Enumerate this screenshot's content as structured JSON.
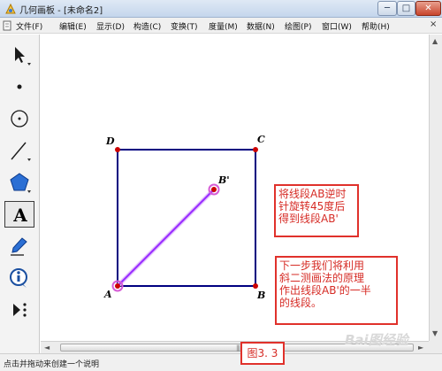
{
  "window": {
    "title": "几何画板 - [未命名2]",
    "minimize": "─",
    "maximize": "□",
    "close": "✕"
  },
  "menu": {
    "items": [
      "文件(F)",
      "编辑(E)",
      "显示(D)",
      "构造(C)",
      "变换(T)",
      "度量(M)",
      "数据(N)",
      "绘图(P)",
      "窗口(W)",
      "帮助(H)"
    ],
    "close_glyph": "×"
  },
  "tools": [
    {
      "icon": "arrow-select-icon"
    },
    {
      "icon": "point-icon"
    },
    {
      "icon": "compass-icon"
    },
    {
      "icon": "straightedge-icon"
    },
    {
      "icon": "polygon-icon"
    },
    {
      "icon": "text-icon",
      "glyph": "A",
      "selected": true
    },
    {
      "icon": "marker-icon"
    },
    {
      "icon": "information-icon"
    },
    {
      "icon": "custom-tool-icon"
    }
  ],
  "diagram": {
    "points": {
      "A": {
        "label": "A"
      },
      "B": {
        "label": "B"
      },
      "C": {
        "label": "C"
      },
      "D": {
        "label": "D"
      },
      "B_prime": {
        "label": "B'"
      }
    },
    "square_color": "#000080",
    "segment_color": "#9b30ff",
    "point_color": "#cc0000"
  },
  "notes": {
    "note1": [
      "将线段AB逆时",
      "针旋转45度后",
      "得到线段AB'"
    ],
    "note2": [
      "下一步我们将利用",
      "斜二测画法的原理",
      "作出线段AB'的一半",
      "的线段。"
    ]
  },
  "figure_label": "图3. 3",
  "status": "点击并拖动来创建一个说明",
  "watermark": "Bai图经验",
  "scroll": {
    "left_arrow": "◄",
    "right_arrow": "►",
    "up_arrow": "▲",
    "down_arrow": "▼",
    "grip": "|||"
  },
  "colors": {
    "accent": "#e0312b"
  }
}
